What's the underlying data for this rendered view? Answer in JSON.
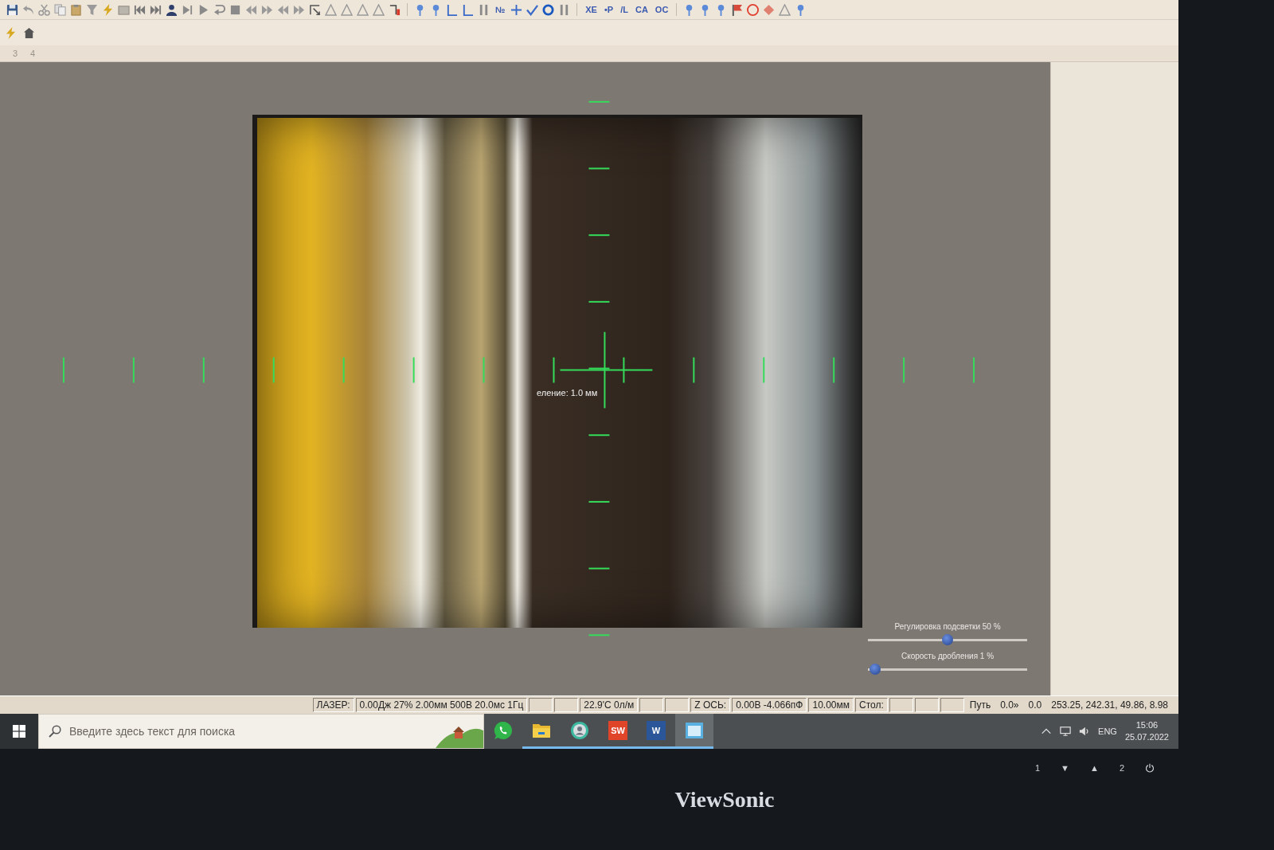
{
  "toolbar": {
    "labels": [
      "№",
      "XE",
      "•P",
      "/L",
      "CA",
      "OC"
    ]
  },
  "ruler_labels": [
    "3",
    "4"
  ],
  "viewer": {
    "scale_label": "еление: 1.0 мм",
    "sliders": [
      {
        "label": "Регулировка подсветки 50 %",
        "level": 0.5
      },
      {
        "label": "Скорость дробления 1 %",
        "level": 0.01
      }
    ]
  },
  "status_bar": {
    "cells": [
      {
        "kind": "text",
        "text": "ЛАЗЕР:"
      },
      {
        "kind": "text",
        "text": "0.00Дж 27% 2.00мм 500В 20.0мс 1Гц"
      },
      {
        "kind": "blank"
      },
      {
        "kind": "blank"
      },
      {
        "kind": "text",
        "text": "22.9'C 0л/м"
      },
      {
        "kind": "blank"
      },
      {
        "kind": "blank"
      },
      {
        "kind": "text",
        "text": "Z ОСЬ:"
      },
      {
        "kind": "text",
        "text": "0.00В -4.066пФ"
      },
      {
        "kind": "text",
        "text": "10.00мм"
      },
      {
        "kind": "text",
        "text": "Стол:"
      },
      {
        "kind": "blank"
      },
      {
        "kind": "blank"
      },
      {
        "kind": "blank"
      },
      {
        "kind": "plain",
        "text": "Путь"
      },
      {
        "kind": "plain",
        "text": "0.0»"
      },
      {
        "kind": "plain",
        "text": "0.0"
      },
      {
        "kind": "plain",
        "text": "253.25, 242.31, 49.86, 8.98"
      }
    ]
  },
  "taskbar": {
    "search": {
      "placeholder": "Введите здесь текст для поиска"
    },
    "apps": [
      {
        "kind": "chat",
        "open": false,
        "selected": false
      },
      {
        "kind": "folder",
        "open": true,
        "selected": false
      },
      {
        "kind": "avatar",
        "open": true,
        "selected": false
      },
      {
        "kind": "tile",
        "label": "SW",
        "color": "#e0452a",
        "open": true,
        "selected": false
      },
      {
        "kind": "tile",
        "label": "W",
        "color": "#2b579a",
        "open": true,
        "selected": false
      },
      {
        "kind": "window",
        "open": true,
        "selected": true
      }
    ],
    "tray": {
      "language": "ENG",
      "time": "15:06",
      "date": "25.07.2022"
    }
  },
  "monitor": {
    "brand": "ViewSonic",
    "buttons": [
      {
        "kind": "text",
        "label": "1"
      },
      {
        "kind": "text",
        "label": "▼"
      },
      {
        "kind": "text",
        "label": "▲"
      },
      {
        "kind": "text",
        "label": "2"
      },
      {
        "kind": "power"
      }
    ]
  }
}
